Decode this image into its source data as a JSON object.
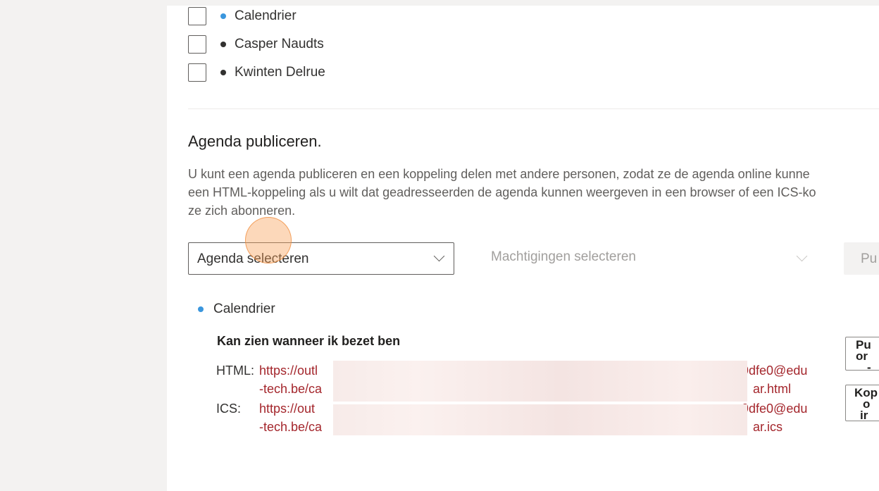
{
  "calendars": [
    {
      "label": "Calendrier",
      "dot_color": "#3a96dd"
    },
    {
      "label": "Casper Naudts",
      "dot_color": "#323130"
    },
    {
      "label": "Kwinten Delrue",
      "dot_color": "#323130"
    }
  ],
  "publish": {
    "title": "Agenda publiceren.",
    "description_lines": [
      "U kunt een agenda publiceren en een koppeling delen met andere personen, zodat ze de agenda online kunne",
      "een HTML-koppeling als u wilt dat geadresseerden de agenda kunnen weergeven in een browser of een ICS-ko",
      "ze zich abonneren."
    ],
    "calendar_select": {
      "value": "Agenda selecteren"
    },
    "permissions_select": {
      "placeholder": "Machtigingen selecteren"
    },
    "publish_button_label": "Pu"
  },
  "published": {
    "calendar_name": "Calendrier",
    "dot_color": "#3a96dd",
    "permission_title": "Kan zien wanneer ik bezet ben",
    "html": {
      "label": "HTML:",
      "line1_start": "https://outl",
      "line1_end": "9dfe0@edu",
      "line2_start": "-tech.be/ca",
      "line2_end": "ar.html"
    },
    "ics": {
      "label": "ICS:",
      "line1_start": "https://out",
      "line1_end": "9dfe0@edu",
      "line2_start": "-tech.be/ca",
      "line2_end": "ar.ics"
    },
    "side_buttons": [
      {
        "lines": [
          "Pu",
          "or",
          "-"
        ]
      },
      {
        "lines": [
          "Kop",
          "o",
          "ir"
        ]
      }
    ]
  },
  "colors": {
    "link": "#a4262c",
    "highlight": "#f8a15a"
  }
}
